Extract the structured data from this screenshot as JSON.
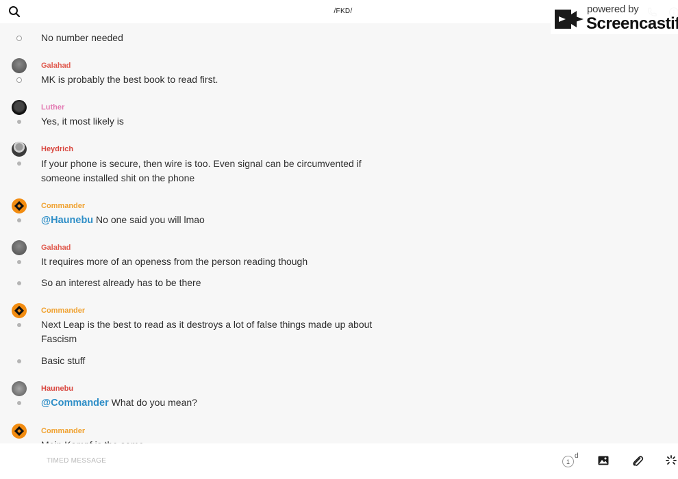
{
  "header": {
    "title": "/FKD/",
    "search_icon": "search-icon",
    "call_icon": "phone-icon",
    "info_icon": "info-icon"
  },
  "watermark": {
    "powered": "powered by",
    "brand": "Screencastify"
  },
  "colors": {
    "galahad": "#e05a4e",
    "luther": "#e37bb3",
    "heydrich": "#d9473f",
    "commander": "#f0a231",
    "haunebu": "#d9473f",
    "mention": "#2e8ec7"
  },
  "messages": [
    {
      "text": "No number needed",
      "marker": "clock"
    },
    {
      "author": "Galahad",
      "avatar": "gray",
      "text": "MK is probably the best book to read first.",
      "marker": "clock"
    },
    {
      "author": "Luther",
      "avatar": "dark",
      "text": "Yes, it most likely is",
      "marker": "dot"
    },
    {
      "author": "Heydrich",
      "avatar": "suit",
      "text": "If your phone is secure, then wire is too. Even signal can be circumvented if someone installed shit on the phone",
      "marker": "dot"
    },
    {
      "author": "Commander",
      "avatar": "diamond",
      "mention": "@Haunebu",
      "text": " No one said you will lmao",
      "marker": "dot"
    },
    {
      "author": "Galahad",
      "avatar": "gray",
      "text": "It requires more of an openess from the person reading though",
      "marker": "dot"
    },
    {
      "text": "So an interest already has to be there",
      "marker": "dot"
    },
    {
      "author": "Commander",
      "avatar": "diamond",
      "text": "Next Leap is the best to read as it destroys a lot of false things made up about Fascism",
      "marker": "dot"
    },
    {
      "text": "Basic stuff",
      "marker": "dot"
    },
    {
      "author": "Haunebu",
      "avatar": "photo",
      "mention": "@Commander",
      "text": " What do you mean?",
      "marker": "dot"
    },
    {
      "author": "Commander",
      "avatar": "diamond",
      "text": "Mein Kampf is the same"
    }
  ],
  "composer": {
    "placeholder": "TIMED MESSAGE",
    "timer_value": "1",
    "timer_unit": "d"
  }
}
